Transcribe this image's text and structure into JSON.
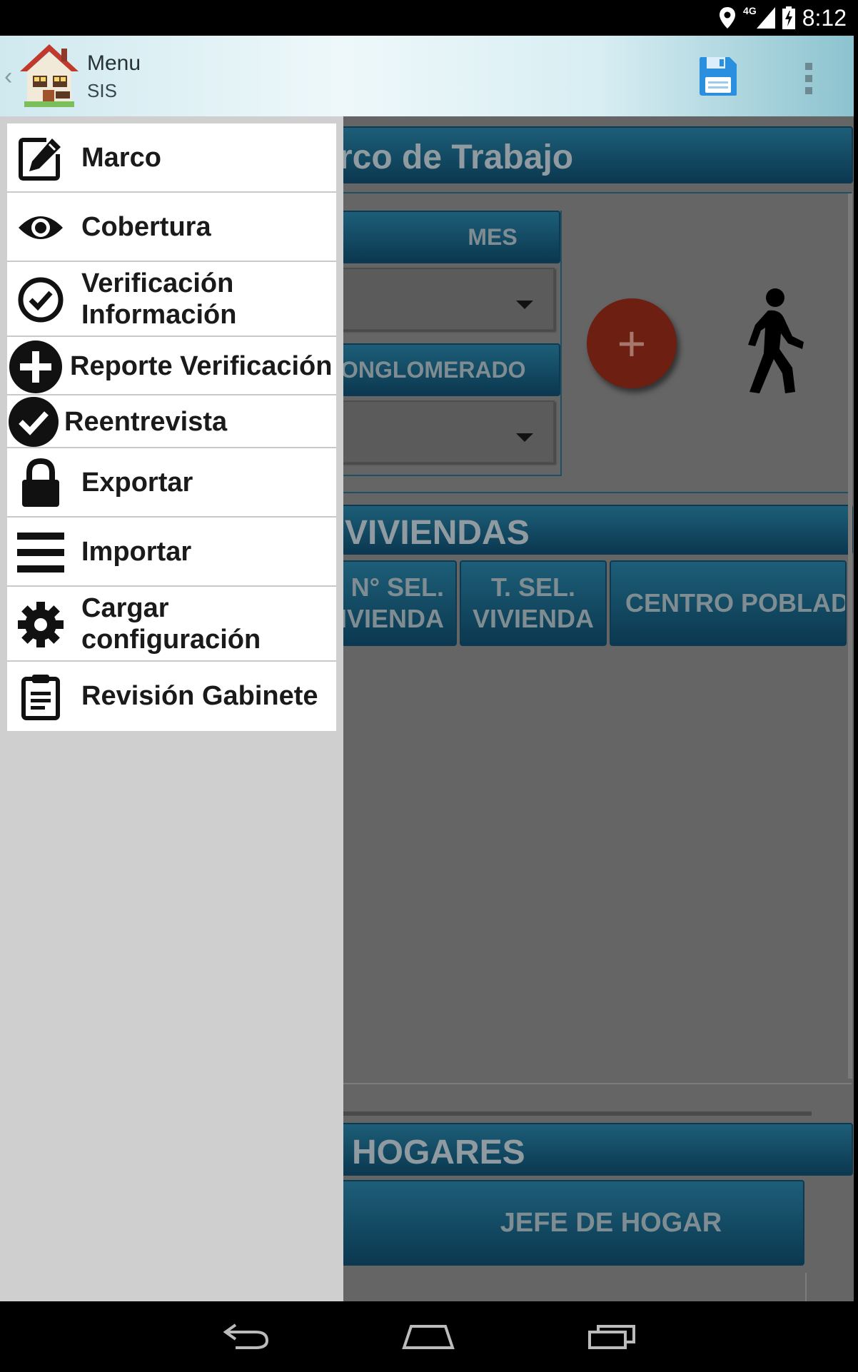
{
  "status_bar": {
    "network": "4G",
    "time": "8:12"
  },
  "action_bar": {
    "title": "Menu",
    "subtitle": "SIS"
  },
  "background": {
    "frame_header": "rco de Trabajo",
    "month_label": "MES",
    "cluster_label": "ONGLOMERADO",
    "dwellings_header": "VIVIENDAS",
    "columns": [
      {
        "line1": "N° SEL.",
        "line2": "IVIENDA"
      },
      {
        "line1": "T. SEL.",
        "line2": "VIVIENDA"
      },
      {
        "line1": "CENTRO POBLADO",
        "line2": ""
      }
    ],
    "households_header": "HOGARES",
    "household_head_label": "JEFE DE HOGAR",
    "add_button_glyph": "+"
  },
  "drawer": {
    "items": [
      {
        "label": "Marco",
        "icon": "edit-icon"
      },
      {
        "label": "Cobertura",
        "icon": "eye-icon"
      },
      {
        "label": "Verificación\nInformación",
        "line1": "Verificación",
        "line2": "Información",
        "icon": "check-circle-outline-icon"
      },
      {
        "label": "Reporte Verificación",
        "icon": "plus-circle-icon"
      },
      {
        "label": "Reentrevista",
        "icon": "check-circle-filled-icon"
      },
      {
        "label": "Exportar",
        "icon": "lock-icon"
      },
      {
        "label": "Importar",
        "icon": "menu-lines-icon"
      },
      {
        "label": "Cargar\nconfiguración",
        "line1": "Cargar",
        "line2": "configuración",
        "icon": "gear-icon"
      },
      {
        "label": "Revisión Gabinete",
        "icon": "clipboard-icon"
      }
    ]
  },
  "colors": {
    "accent_header": "#0b3850",
    "fab": "#6d1f12",
    "save_icon": "#2b8fe0"
  }
}
